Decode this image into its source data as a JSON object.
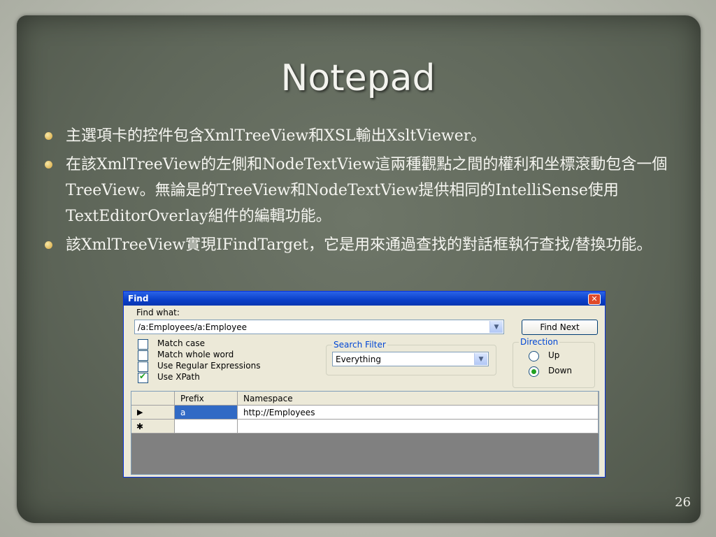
{
  "slide": {
    "title": "Notepad",
    "bullets": [
      "主選項卡的控件包含XmlTreeView和XSL輸出XsltViewer。",
      "在該XmlTreeView的左側和NodeTextView這兩種觀點之間的權利和坐標滾動包含一個TreeView。無論是的TreeView和NodeTextView提供相同的IntelliSense使用TextEditorOverlay組件的編輯功能。",
      "該XmlTreeView實現IFindTarget，它是用來通過查找的對話框執行查找/替換功能。"
    ],
    "page_number": "26"
  },
  "dialog": {
    "title": "Find",
    "find_what_label": "Find what:",
    "find_what_value": "/a:Employees/a:Employee",
    "find_next_label": "Find Next",
    "options": [
      {
        "label": "Match case",
        "checked": false
      },
      {
        "label": "Match whole word",
        "checked": false
      },
      {
        "label": "Use Regular Expressions",
        "checked": false
      },
      {
        "label": "Use XPath",
        "checked": true
      }
    ],
    "search_filter": {
      "title": "Search Filter",
      "value": "Everything"
    },
    "direction": {
      "title": "Direction",
      "up_label": "Up",
      "down_label": "Down",
      "selected": "Down"
    },
    "grid": {
      "headers": [
        "Prefix",
        "Namespace"
      ],
      "rows": [
        {
          "marker": "▶",
          "prefix": "a",
          "namespace": "http://Employees"
        },
        {
          "marker": "✱",
          "prefix": "",
          "namespace": ""
        }
      ]
    },
    "colors": {
      "titlebar": "#0a3fc8",
      "selection": "#316ac5"
    }
  }
}
